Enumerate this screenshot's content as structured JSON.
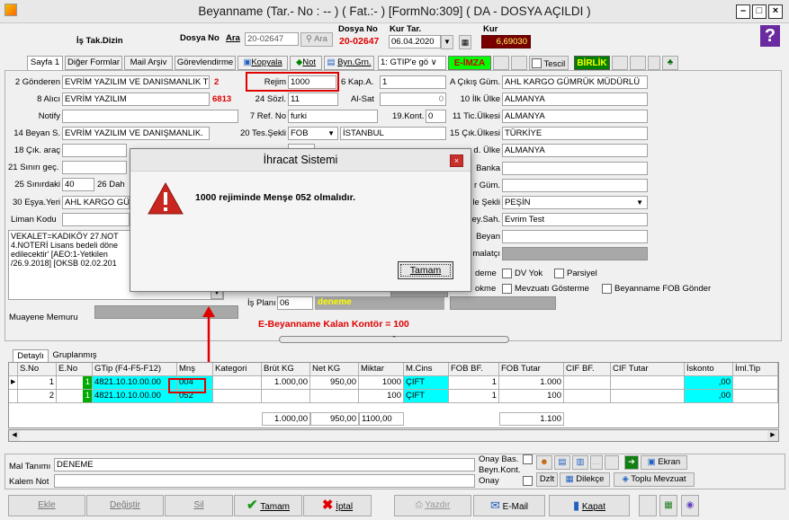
{
  "window": {
    "title": "Beyanname (Tar.- No : -- ) ( Fat.:- )  [FormNo:309]  ( DA - DOSYA AÇILDI )",
    "min": "–",
    "max": "□",
    "close": "×"
  },
  "header": {
    "is_tak": "İş Tak.Dizin",
    "dosya_no_label": "Dosya No",
    "ara_label": "Ara",
    "dosya_no_value": "20-02647",
    "ara_btn": "Ara",
    "dosya_no2_label": "Dosya No",
    "dosya_no2_value": "20-02647",
    "kur_tar_label": "Kur Tar.",
    "kur_tar_value": "06.04.2020",
    "kur_label": "Kur",
    "kur_value": "6,69030"
  },
  "tabs": {
    "sayfa1": "Sayfa 1",
    "diger": "Diğer Formlar",
    "mail": "Mail Arşiv",
    "gorev": "Görevlendirme",
    "kopyala": "Kopyala",
    "not": "Not",
    "byn": "Byn.Grn.",
    "gtip": "1: GTIP'e gö",
    "eimza": "E-İMZA",
    "tescil": "Tescil",
    "birlik": "BİRLİK"
  },
  "left": {
    "gonderen_label": "2 Gönderen",
    "gonderen_value": "EVRİM YAZILIM VE DANISMANLIK T",
    "gonderen_num": "2",
    "alici_label": "8 Alıcı",
    "alici_value": "EVRİM YAZILIM",
    "alici_num": "6813",
    "notify_label": "Notify",
    "beyan_label": "14 Beyan S.",
    "beyan_value": "EVRİM YAZILIM VE DANIŞMANLIK.",
    "cik_arac_label": "18 Çık. araç",
    "sinir_gec_label": "21 Sınırı geç.",
    "sinirdaki_label": "25 Sınırdaki",
    "sinirdaki_value": "40",
    "dahili_label": "26 Dah",
    "esya_label": "30 Eşya.Yeri",
    "esya_value": "AHL KARGO GÜ",
    "liman_label": "Liman Kodu",
    "notes": [
      "VEKALET=KADIKÖY 27.NOT",
      "4.NOTERİ Lisans bedeli döne",
      "edilecektir'   [AEO:1-Yetkilen",
      "/26.9.2018] [OKSB 02.02.201"
    ],
    "muayene_label": "Muayene Memuru"
  },
  "mid": {
    "rejim_label": "Rejim",
    "rejim_value": "1000",
    "kap_label": "6 Kap.A.",
    "kap_value": "1",
    "sozl_label": "24 Sözl.",
    "sozl_value": "11",
    "alsat_label": "Al-Sat",
    "alsat_value": "0",
    "ref_label": "7 Ref. No",
    "ref_value": "furki",
    "kont_label": "19.Kont.",
    "kont_value": "0",
    "tes_label": "20 Tes.Şekli",
    "tes_value": "FOB",
    "tes_city": "İSTANBUL",
    "is_plani_label": "İş Planı",
    "is_plani_value": "06",
    "is_plani_text": "deneme",
    "kontor": "E-Beyanname Kalan Kontör = 100"
  },
  "right": {
    "cikis_label": "A Çıkış Güm.",
    "cikis_value": "AHL KARGO GÜMRÜK MÜDÜRLÜ",
    "ilk_label": "10 İlk Ülke",
    "ilk_value": "ALMANYA",
    "tic_label": "11 Tic.Ülkesi",
    "tic_value": "ALMANYA",
    "cik_label": "15 Çık.Ülkesi",
    "cik_value": "TÜRKİYE",
    "gid_label": "d. Ülke",
    "gid_value": "ALMANYA",
    "banka_label": "Banka",
    "gum_label": "r Güm.",
    "odeme_label": "le Şekli",
    "odeme_value": "PEŞİN",
    "beysah_label": "ey.Sah.",
    "beysah_value": "Evrim Test",
    "beyan_label": "Beyan",
    "malatci_label": "malatçı",
    "deme": "deme",
    "dvyok": "DV Yok",
    "parsiyel": "Parsiyel",
    "okme": "okme",
    "mevzuati": "Mevzuatı Gösterme",
    "fob": "Beyanname FOB Gönder"
  },
  "dialog": {
    "title": "İhracat Sistemi",
    "message": "1000 rejiminde Menşe 052 olmalıdır.",
    "ok": "Tamam",
    "close": "×"
  },
  "annotation": {
    "num": "2"
  },
  "grid": {
    "tabs": [
      "Detaylı",
      "Gruplanmış"
    ],
    "headers": [
      "S.No",
      "E.No",
      "GTip (F4-F5-F12)",
      "Mnş",
      "Kategori",
      "Brüt KG",
      "Net KG",
      "Miktar",
      "M.Cins",
      "FOB BF.",
      "FOB Tutar",
      "CIF BF.",
      "CIF Tutar",
      "İskonto",
      "İml.Tip"
    ],
    "rows": [
      {
        "sno": "1",
        "eno": "1",
        "gtip": "4821.10.10.00.00",
        "mns": "004",
        "brut": "1.000,00",
        "net": "950,00",
        "miktar": "1000",
        "mcins": "ÇIFT",
        "fobbf": "1",
        "fobtutar": "1.000",
        "iskonto": ",00"
      },
      {
        "sno": "2",
        "eno": "1",
        "gtip": "4821.10.10.00.00",
        "mns": "052",
        "brut": "",
        "net": "",
        "miktar": "100",
        "mcins": "ÇIFT",
        "fobbf": "1",
        "fobtutar": "100",
        "iskonto": ",00"
      }
    ],
    "totals": {
      "brut": "1.000,00",
      "net": "950,00",
      "miktar": "1100,00",
      "fob": "1.100"
    }
  },
  "bottom": {
    "mal_label": "Mal Tanımı",
    "mal_value": "DENEME",
    "kalem_label": "Kalem Not",
    "onay_bas": "Onay Bas.",
    "beyn_kont": "Beyn.Kont.",
    "onay": "Onay",
    "ekran": "Ekran",
    "dzlt": "Dzlt",
    "dilekce": "Dilekçe",
    "toplu": "Toplu Mevzuat",
    "ekle": "Ekle",
    "degistir": "Değiştir",
    "sil": "Sil",
    "tamam": "Tamam",
    "iptal": "İptal",
    "yazdir": "Yazdır",
    "email": "E-Mail",
    "kapat": "Kapat"
  },
  "colors": {
    "red": "#e00000",
    "cyan": "#00ffff",
    "green_eimza": "#00ff00",
    "birlik_bg": "#008000",
    "kur_bg": "#7a0000",
    "kur_fg": "#ffff66",
    "grey_field": "#a8a8a8"
  }
}
